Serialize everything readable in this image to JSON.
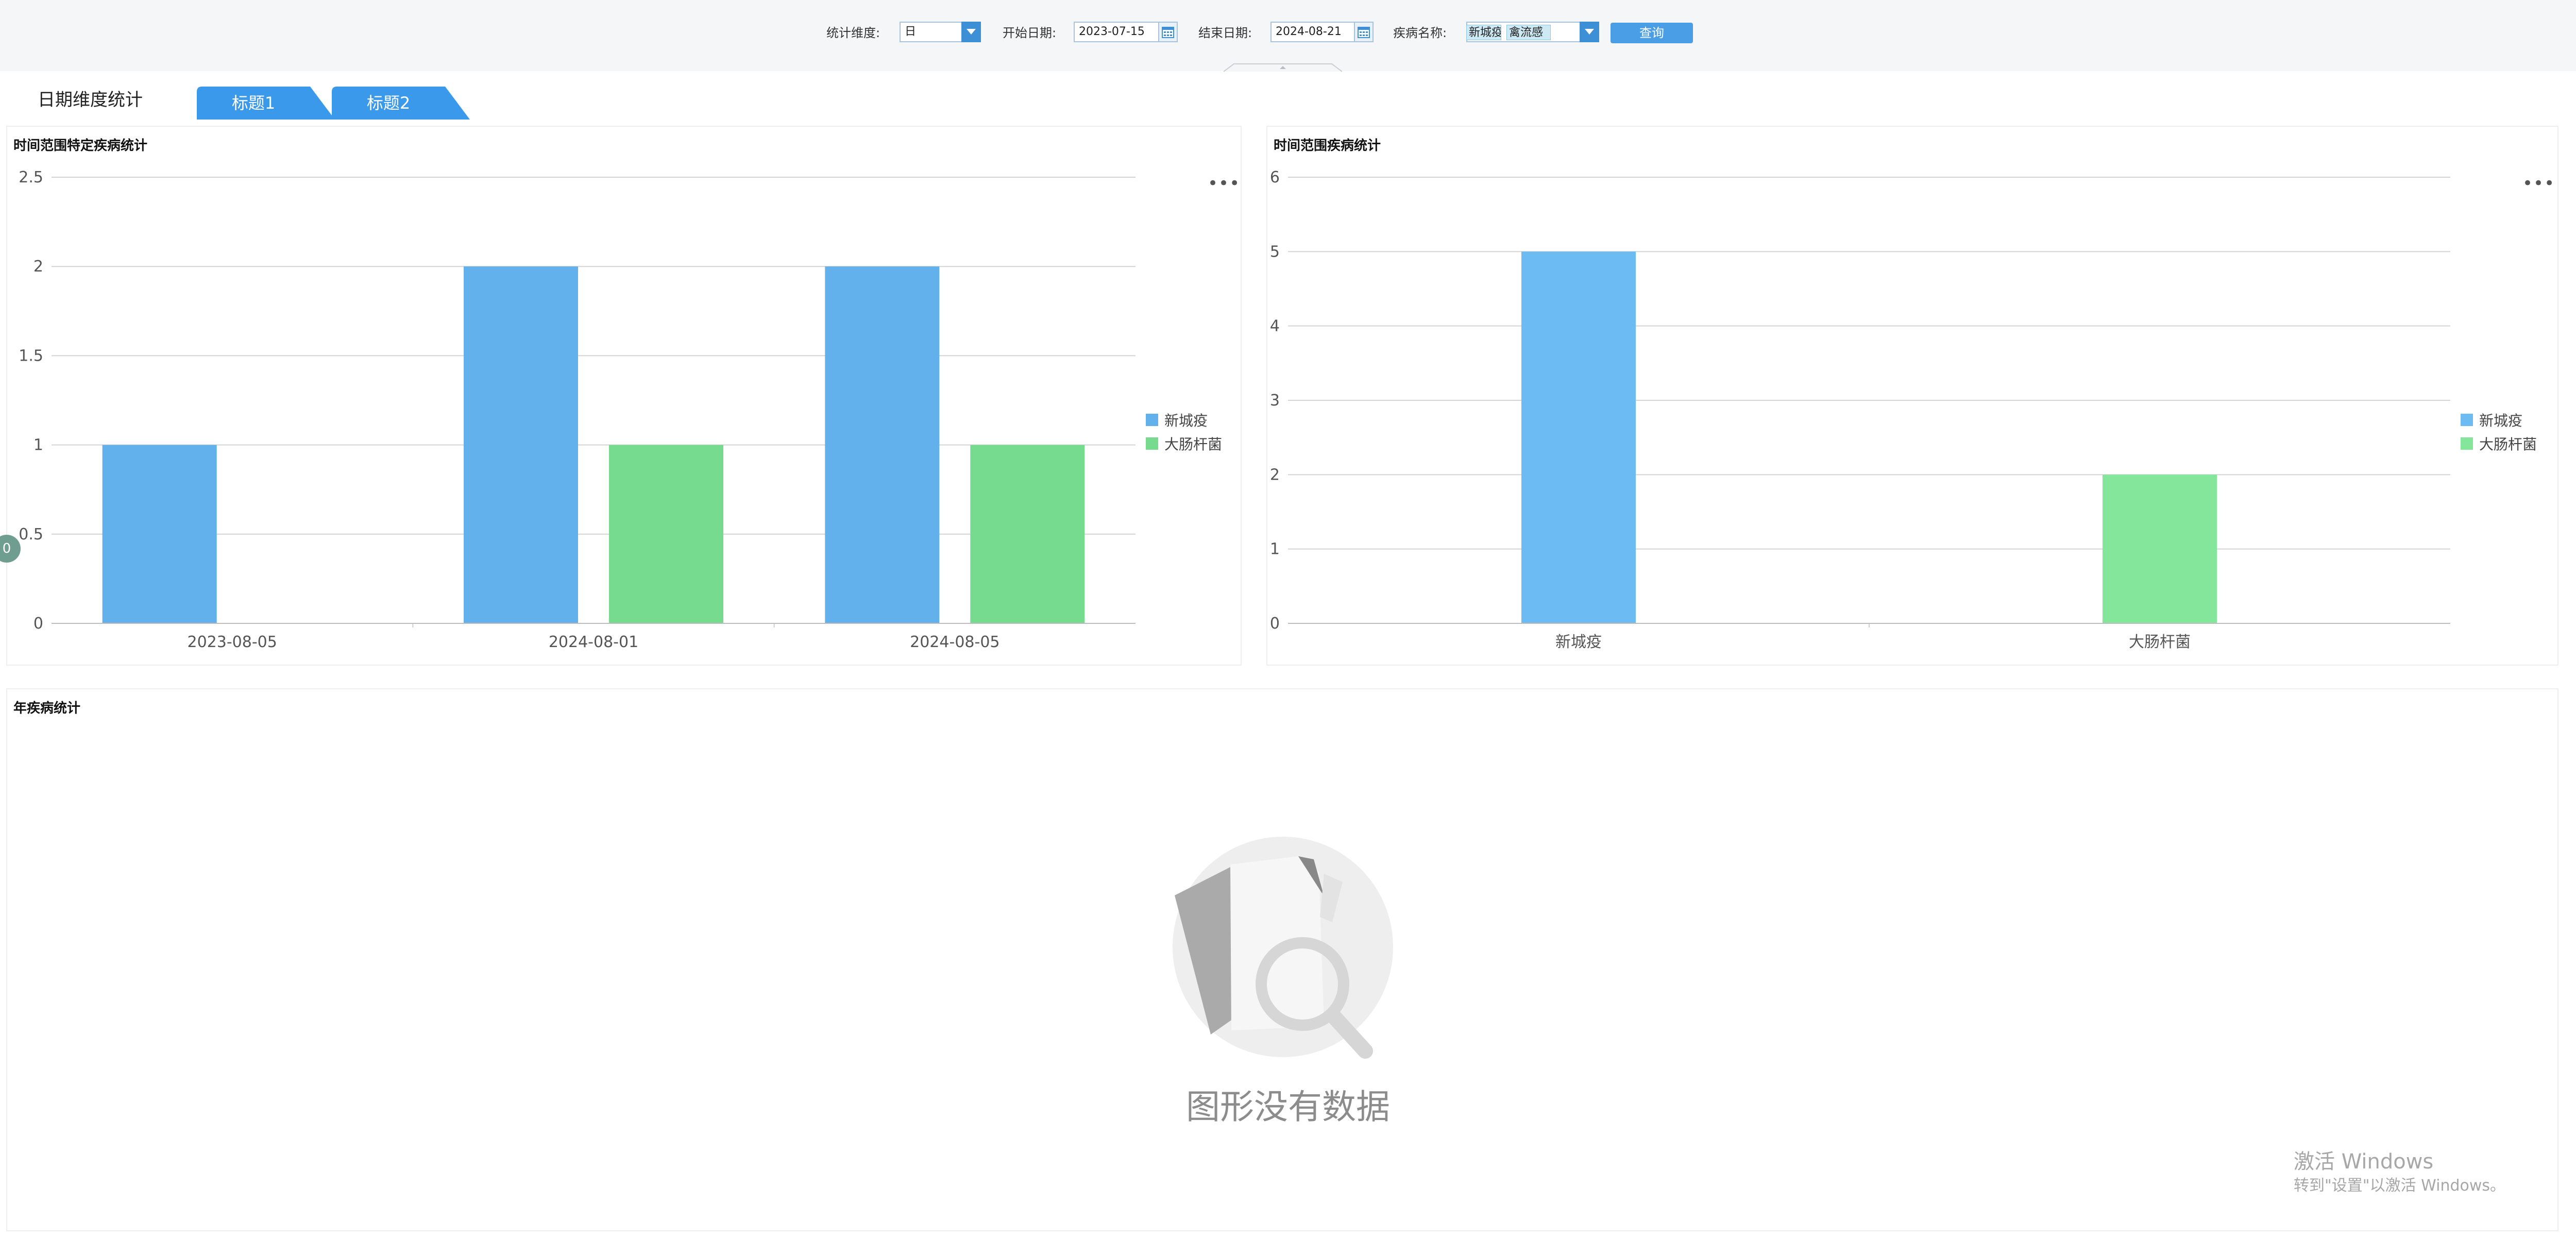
{
  "filters": {
    "dimension_label": "统计维度:",
    "dimension_value": "日",
    "start_label": "开始日期:",
    "start_value": "2023-07-15",
    "end_label": "结束日期:",
    "end_value": "2024-08-21",
    "disease_label": "疾病名称:",
    "disease_tags": [
      "新城疫",
      "禽流感"
    ],
    "query_label": "查询"
  },
  "tabs": {
    "active_label": "日期维度统计",
    "tab1_label": "标题1",
    "tab2_label": "标题2",
    "blue_color": "#3b99ec"
  },
  "panels": {
    "left_title": "时间范围特定疾病统计",
    "right_title": "时间范围疾病统计",
    "bottom_title": "年疾病统计",
    "more_icon": "more-horizontal-icon",
    "left_badge": "0"
  },
  "empty_state": {
    "icon": "empty-chart-search-icon",
    "text": "图形没有数据"
  },
  "watermark": {
    "line1": "激活 Windows",
    "line2": "转到\"设置\"以激活 Windows。"
  },
  "chart_data": [
    {
      "type": "bar",
      "title": "时间范围特定疾病统计",
      "categories": [
        "2023-08-05",
        "2024-08-01",
        "2024-08-05"
      ],
      "series": [
        {
          "name": "新城疫",
          "values": [
            1,
            2,
            2
          ],
          "color": "#62b0ec"
        },
        {
          "name": "大肠杆菌",
          "values": [
            0,
            1,
            1
          ],
          "color": "#77db8f"
        }
      ],
      "ylim": [
        0,
        2.5
      ],
      "yticks": [
        "0",
        "0.5",
        "1",
        "1.5",
        "2",
        "2.5"
      ],
      "grid": true,
      "legend": "right"
    },
    {
      "type": "bar",
      "title": "时间范围疾病统计",
      "categories": [
        "新城疫",
        "大肠杆菌"
      ],
      "series": [
        {
          "name": "新城疫",
          "values": [
            5,
            0
          ],
          "color": "#6cbcf3"
        },
        {
          "name": "大肠杆菌",
          "values": [
            0,
            2
          ],
          "color": "#83e69b"
        }
      ],
      "ylim": [
        0,
        6
      ],
      "yticks": [
        "0",
        "1",
        "2",
        "3",
        "4",
        "5",
        "6"
      ],
      "grid": true,
      "legend": "right"
    }
  ]
}
